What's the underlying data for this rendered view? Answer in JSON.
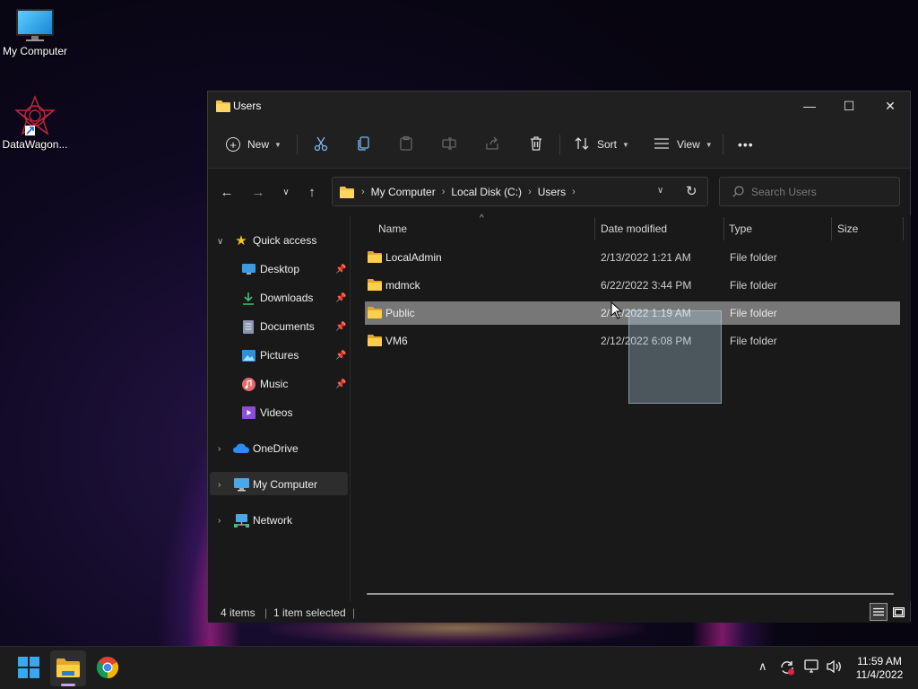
{
  "desktop": {
    "icons": [
      {
        "label": "My Computer",
        "icon": "monitor-icon"
      },
      {
        "label": "DataWagon...",
        "icon": "datawagon-logo"
      }
    ]
  },
  "window": {
    "title": "Users",
    "controls": {
      "minimize": "—",
      "maximize": "☐",
      "close": "✕"
    }
  },
  "toolbar": {
    "new_label": "New",
    "sort_label": "Sort",
    "view_label": "View",
    "more_label": "•••"
  },
  "navigation": {
    "breadcrumbs": [
      "My Computer",
      "Local Disk (C:)",
      "Users"
    ],
    "search_placeholder": "Search Users"
  },
  "sidebar": {
    "quick_access": "Quick access",
    "quick_items": [
      {
        "label": "Desktop",
        "icon": "desktop-icon",
        "pinned": true
      },
      {
        "label": "Downloads",
        "icon": "download-icon",
        "pinned": true
      },
      {
        "label": "Documents",
        "icon": "document-icon",
        "pinned": true
      },
      {
        "label": "Pictures",
        "icon": "pictures-icon",
        "pinned": true
      },
      {
        "label": "Music",
        "icon": "music-icon",
        "pinned": true
      },
      {
        "label": "Videos",
        "icon": "videos-icon",
        "pinned": false
      }
    ],
    "onedrive": "OneDrive",
    "my_computer": "My Computer",
    "network": "Network"
  },
  "columns": {
    "name": "Name",
    "date": "Date modified",
    "type": "Type",
    "size": "Size"
  },
  "files": [
    {
      "name": "LocalAdmin",
      "date": "2/13/2022 1:21 AM",
      "type": "File folder",
      "size": "",
      "selected": false
    },
    {
      "name": "mdmck",
      "date": "6/22/2022 3:44 PM",
      "type": "File folder",
      "size": "",
      "selected": false
    },
    {
      "name": "Public",
      "date": "2/12/2022 1:19 AM",
      "type": "File folder",
      "size": "",
      "selected": true
    },
    {
      "name": "VM6",
      "date": "2/12/2022 6:08 PM",
      "type": "File folder",
      "size": "",
      "selected": false
    }
  ],
  "status": {
    "count": "4 items",
    "selection": "1 item selected"
  },
  "taskbar": {
    "apps": [
      "start-icon",
      "file-explorer-icon",
      "chrome-icon"
    ],
    "time": "11:59 AM",
    "date": "11/4/2022"
  }
}
